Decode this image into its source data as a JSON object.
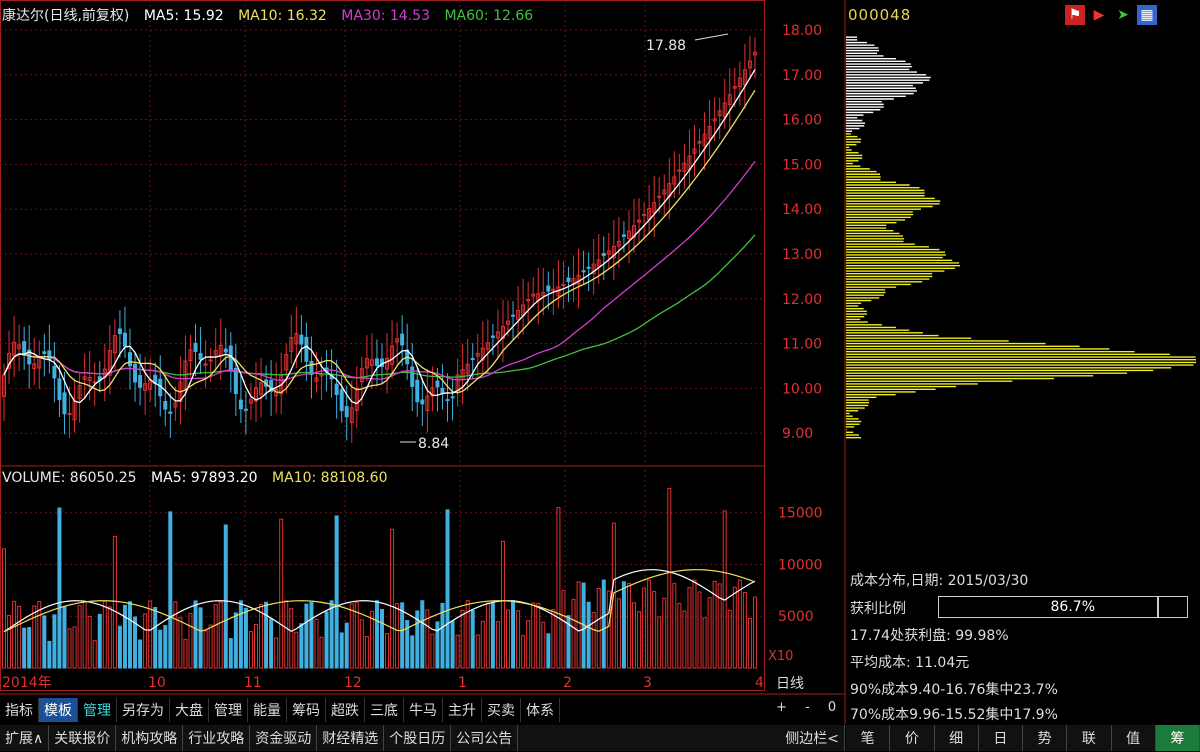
{
  "header": {
    "stock_name": "康达尔(日线,前复权)",
    "ma5": "MA5: 15.92",
    "ma10": "MA10: 16.32",
    "ma30": "MA30: 14.53",
    "ma60": "MA60: 12.66"
  },
  "price_axis": [
    "18.00",
    "17.00",
    "16.00",
    "15.00",
    "14.00",
    "13.00",
    "12.00",
    "11.00",
    "10.00",
    "9.00"
  ],
  "annotations": {
    "high": "17.88",
    "low": "8.84"
  },
  "volume_header": {
    "volume": "VOLUME: 86050.25",
    "ma5": "MA5: 97893.20",
    "ma10": "MA10: 88108.60"
  },
  "volume_axis": [
    "15000",
    "10000",
    "5000"
  ],
  "volume_unit": "X10",
  "date_axis": [
    "2014年",
    "10",
    "11",
    "12",
    "1",
    "2",
    "3",
    "4"
  ],
  "day_control": "日线",
  "zoom_controls": [
    "+",
    "-",
    "0"
  ],
  "stock_code": "000048",
  "cost_info": {
    "title": "成本分布,日期: 2015/03/30",
    "profit_label": "获利比例",
    "profit_value": "86.7%",
    "line1": "17.74处获利盘: 99.98%",
    "line2": "平均成本: 11.04元",
    "line3": "90%成本9.40-16.76集中23.7%",
    "line4": "70%成本9.96-15.52集中17.9%"
  },
  "tabs": [
    "指标",
    "模板",
    "管理",
    "另存为",
    "大盘",
    "管理",
    "能量",
    "筹码",
    "超跌",
    "三底",
    "牛马",
    "主升",
    "买卖",
    "体系"
  ],
  "bottom_tabs": [
    "扩展∧",
    "关联报价",
    "机构攻略",
    "行业攻略",
    "资金驱动",
    "财经精选",
    "个股日历",
    "公司公告",
    "侧边栏<"
  ],
  "right_tabs": [
    "笔",
    "价",
    "细",
    "日",
    "势",
    "联",
    "值",
    "筹"
  ],
  "colors": {
    "ma5": "#ffffff",
    "ma10": "#f0e060",
    "ma30": "#d040d0",
    "ma60": "#40c040",
    "up": "#e03030",
    "down": "#40b0e0",
    "yellow": "#f0f020"
  }
}
